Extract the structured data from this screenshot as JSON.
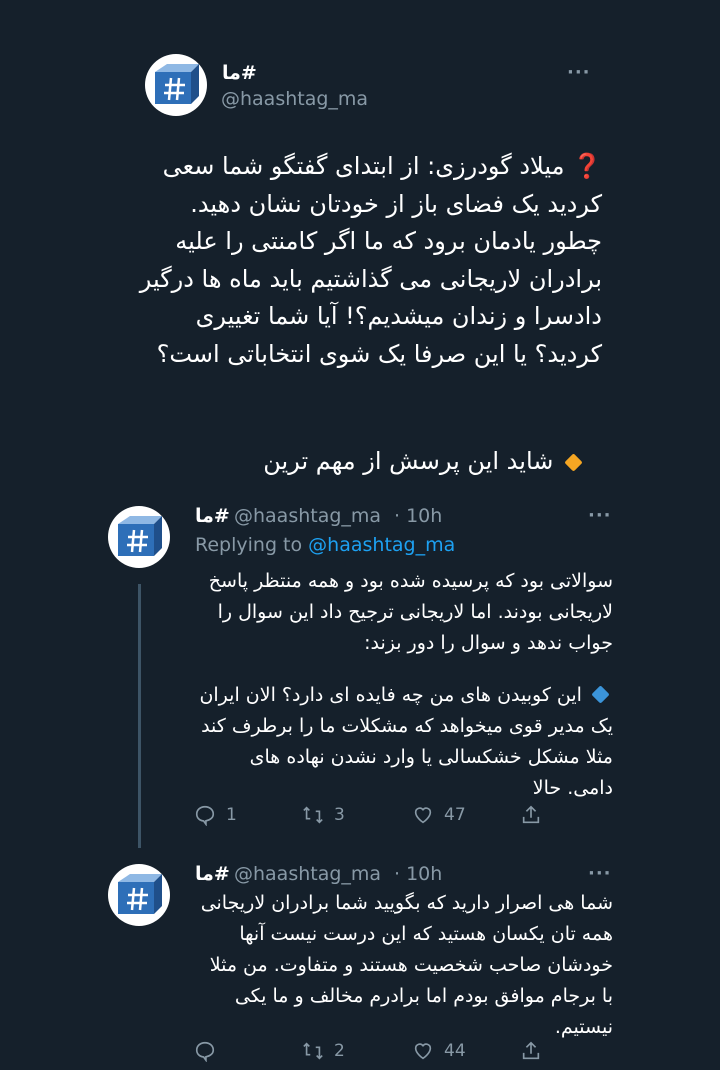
{
  "colors": {
    "background": "#15202b",
    "text": "#ffffff",
    "muted": "#8899a6",
    "link": "#1da1f2",
    "orange_diamond": "#f5a623",
    "blue_diamond": "#3b94d9",
    "question_mark": "#e0245e"
  },
  "main_tweet": {
    "display_name": "#ما",
    "handle": "@haashtag_ma",
    "more_icon": "···",
    "prefix_emoji": "❓",
    "text": "میلاد گودرزی: از ابتدای گفتگو شما سعی کردید یک فضای باز از خودتان نشان دهید. چطور یادمان برود که ما اگر کامنتی را علیه برادران لاریجانی می گذاشتیم باید ماه ها درگیر دادسرا و زندان میشدیم؟! آیا شما تغییری کردید؟ یا این صرفا یک شوی انتخاباتی است؟",
    "extra_text": "شاید این پرسش از مهم ترین"
  },
  "reply1": {
    "display_name": "#ما",
    "handle": "@haashtag_ma",
    "time": "· 10h",
    "replying_prefix": "Replying to",
    "replying_to": "@haashtag_ma",
    "more_icon": "···",
    "paragraph1": "سوالاتی بود که پرسیده شده بود و همه منتظر پاسخ لاریجانی بودند. اما لاریجانی ترجیح داد این سوال را جواب ندهد و سوال را دور بزند:",
    "paragraph2": "این کوبیدن های من چه فایده ای دارد؟ الان ایران یک مدیر قوی میخواهد که مشکلات ما را برطرف کند مثلا مشکل خشکسالی یا وارد نشدن نهاده های دامی. حالا",
    "replies": "1",
    "retweets": "3",
    "likes": "47"
  },
  "reply2": {
    "display_name": "#ما",
    "handle": "@haashtag_ma",
    "time": "· 10h",
    "more_icon": "···",
    "text": "شما هی اصرار دارید که بگویید شما برادران لاریجانی همه تان یکسان هستید که این درست نیست آنها خودشان صاحب شخصیت هستند و متفاوت. من مثلا با برجام موافق بودم اما برادرم مخالف و ما یکی نیستیم.",
    "replies": "",
    "retweets": "2",
    "likes": "44"
  }
}
